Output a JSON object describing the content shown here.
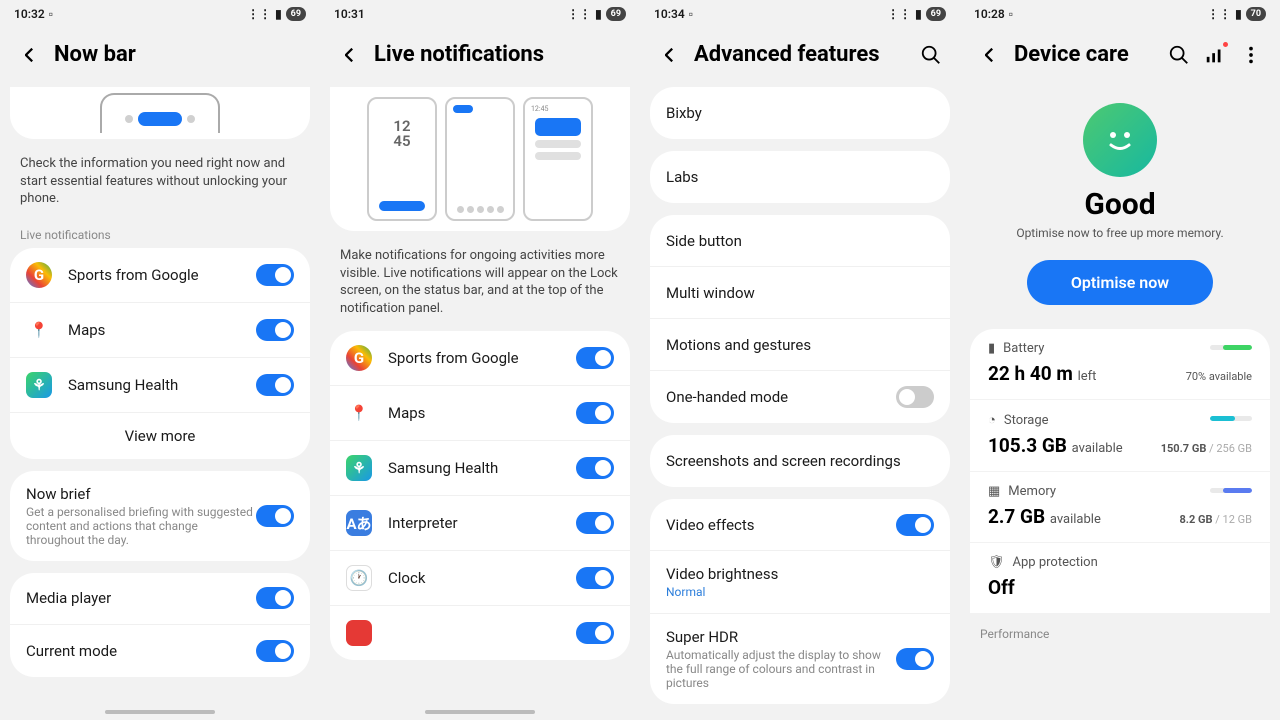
{
  "phone1": {
    "time": "10:32",
    "battery": "69",
    "title": "Now bar",
    "desc": "Check the information you need right now and start essential features without unlocking your phone.",
    "section": "Live notifications",
    "items": [
      {
        "label": "Sports from Google"
      },
      {
        "label": "Maps"
      },
      {
        "label": "Samsung Health"
      }
    ],
    "viewmore": "View more",
    "brief": {
      "title": "Now brief",
      "sub": "Get a personalised briefing with suggested content and actions that change throughout the day."
    },
    "media": "Media player",
    "current": "Current mode"
  },
  "phone2": {
    "time": "10:31",
    "battery": "69",
    "title": "Live notifications",
    "desc": "Make notifications for ongoing activities more visible. Live notifications will appear on the Lock screen, on the status bar, and at the top of the notification panel.",
    "items": [
      {
        "label": "Sports from Google"
      },
      {
        "label": "Maps"
      },
      {
        "label": "Samsung Health"
      },
      {
        "label": "Interpreter"
      },
      {
        "label": "Clock"
      }
    ]
  },
  "phone3": {
    "time": "10:34",
    "battery": "69",
    "title": "Advanced features",
    "bixby": "Bixby",
    "labs": "Labs",
    "items": [
      {
        "label": "Side button"
      },
      {
        "label": "Multi window"
      },
      {
        "label": "Motions and gestures"
      },
      {
        "label": "One-handed mode",
        "toggle": "off"
      }
    ],
    "screenshots": "Screenshots and screen recordings",
    "video": [
      {
        "label": "Video effects",
        "toggle": "on"
      },
      {
        "label": "Video brightness",
        "sub": "Normal"
      },
      {
        "label": "Super HDR",
        "sub": "Automatically adjust the display to show the full range of colours and contrast in pictures",
        "toggle": "on"
      }
    ]
  },
  "phone4": {
    "time": "10:28",
    "battery": "70",
    "title": "Device care",
    "good": "Good",
    "goodsub": "Optimise now to free up more memory.",
    "optimise": "Optimise now",
    "battery_stat": {
      "h": "Battery",
      "v": "22 h 40 m",
      "sub": "left",
      "r": "70% available"
    },
    "storage_stat": {
      "h": "Storage",
      "v": "105.3 GB",
      "sub": "available",
      "r1": "150.7 GB",
      "r2": " / 256 GB"
    },
    "memory_stat": {
      "h": "Memory",
      "v": "2.7 GB",
      "sub": "available",
      "r1": "8.2 GB",
      "r2": " / 12 GB"
    },
    "app": {
      "h": "App protection",
      "v": "Off"
    },
    "perf": "Performance"
  },
  "mini_time": "12\n45"
}
